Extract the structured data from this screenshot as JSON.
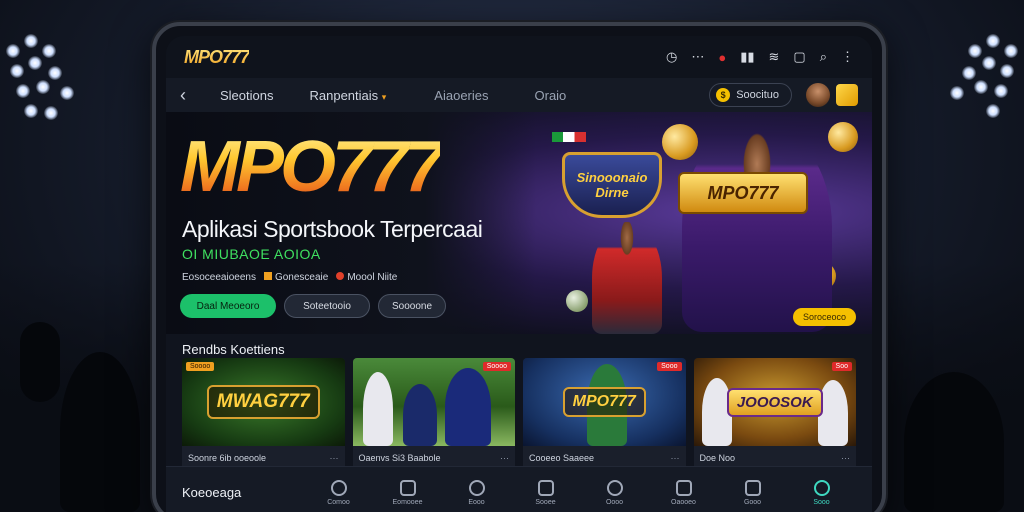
{
  "app": {
    "logo": "MPO777"
  },
  "statusbar": {
    "icons": [
      "clock-icon",
      "dots-icon",
      "record-icon",
      "signal-icon",
      "wifi-icon",
      "window-icon",
      "search-icon",
      "menu-icon"
    ]
  },
  "nav": {
    "items": [
      "Sleotions",
      "Ranpentiais",
      "Aiaoeries",
      "Oraio"
    ],
    "balance_label": "Soocituo"
  },
  "hero": {
    "title": "MPO777",
    "subtitle": "Aplikasi Sportsbook Terpercaai",
    "tagline": "OI MIUBAOE AOIOA",
    "meta": [
      "Eosoceeaioeens",
      "Gonesceaie",
      "Moool Niite"
    ],
    "buttons": {
      "primary": "Daal Meoeoro",
      "secondary": "Soteetooio",
      "tertiary": "Soooone"
    },
    "shield_text": "Sinooonaio Dirne",
    "player_badge": "MPO777",
    "promo_pill": "Soroceoco"
  },
  "featured": {
    "title": "Rendbs Koettiens",
    "cards": [
      {
        "logo": "MWAG777",
        "caption": "Soonre 6ib ooeoole",
        "tag": "Soooo"
      },
      {
        "logo": "",
        "caption": "Oaenvs Si3 Baabole",
        "tag": "Soooo"
      },
      {
        "logo": "MPO777",
        "caption": "Cooeeo Saaeee",
        "tag": "Sooo"
      },
      {
        "logo": "JOOOSOK",
        "caption": "Doe Noo",
        "tag": "Soo"
      }
    ]
  },
  "bottom": {
    "title": "Koeoeaga",
    "tabs": [
      "Comoo",
      "Eomooee",
      "Eooo",
      "Sooee",
      "Oooo",
      "Oaooeo",
      "Gooo",
      "Sooo"
    ]
  },
  "colors": {
    "accent_green": "#1cc06a",
    "accent_gold": "#f5c000",
    "accent_teal": "#3fd8c0",
    "background": "#10141e"
  }
}
